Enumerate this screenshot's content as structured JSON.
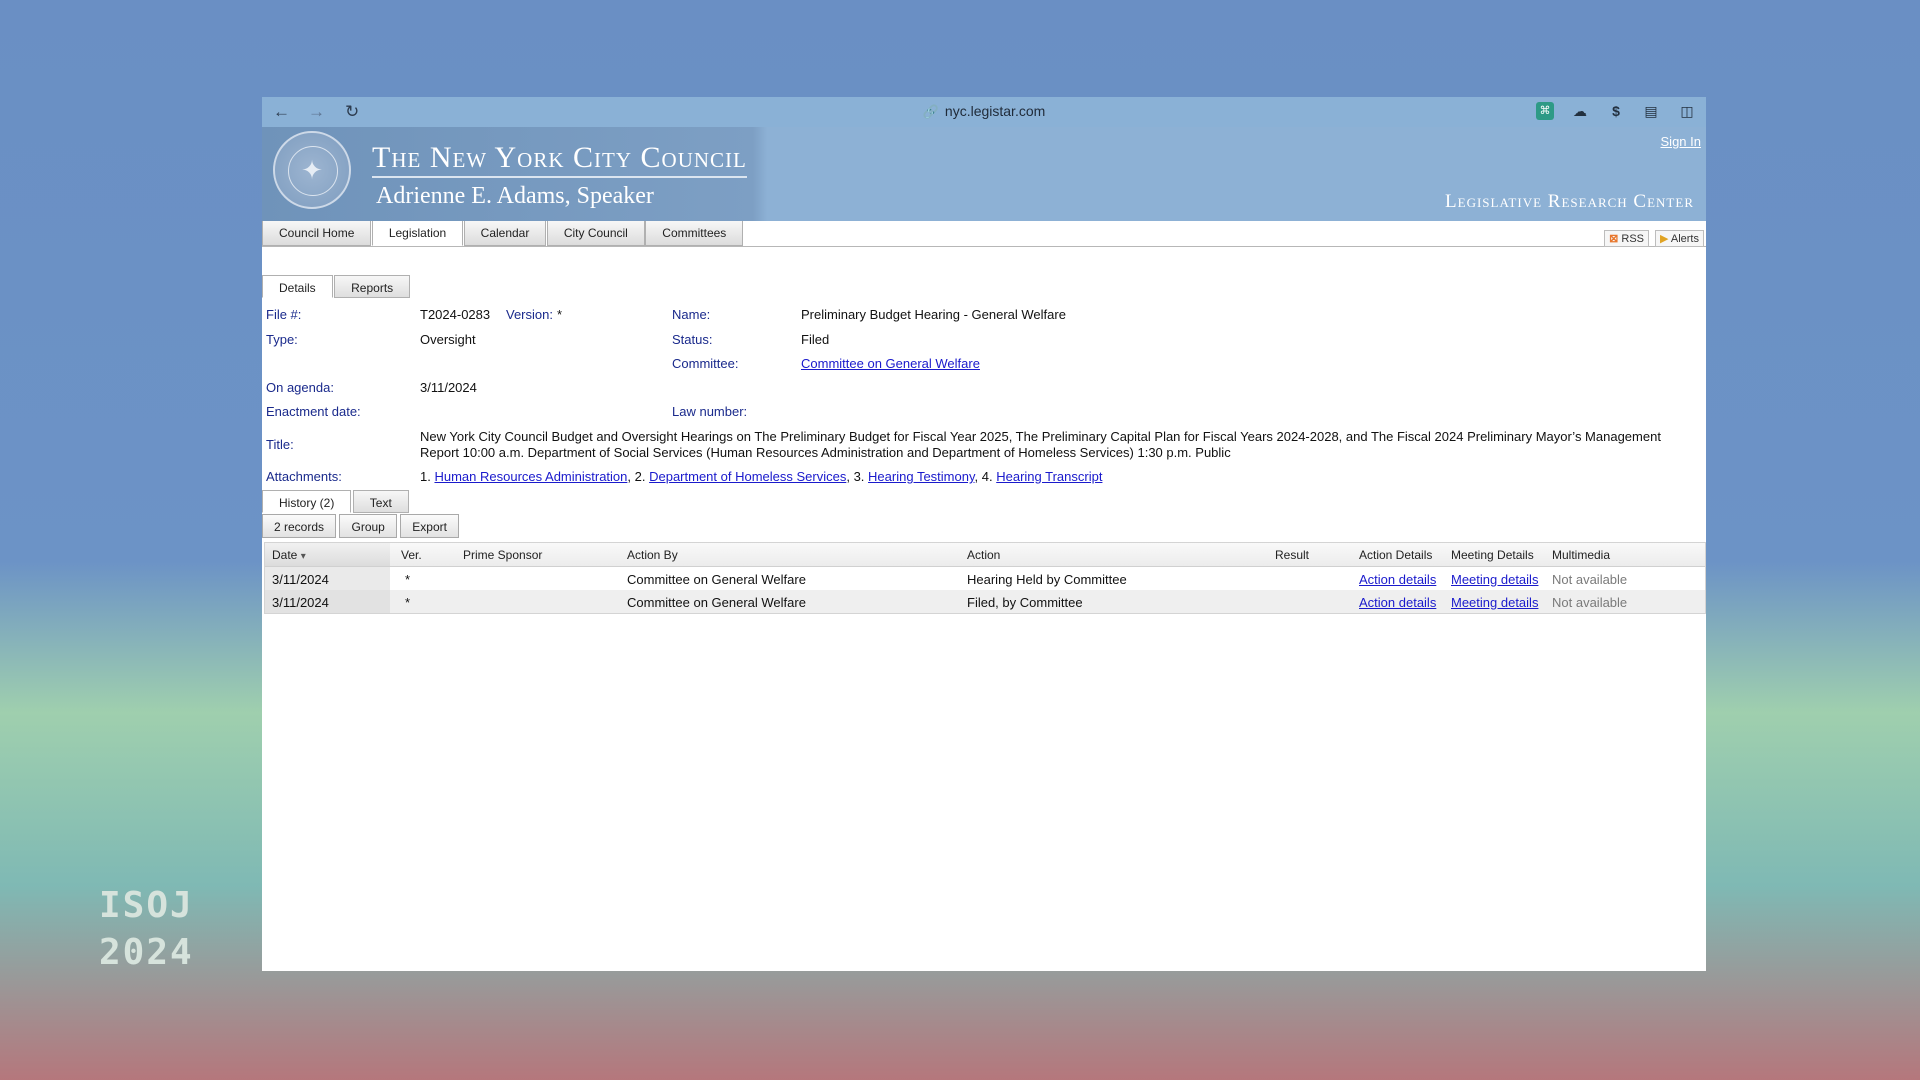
{
  "browser": {
    "url": "nyc.legistar.com",
    "back_glyph": "←",
    "forward_glyph": "→",
    "reload_glyph": "↻"
  },
  "banner": {
    "title": "The New York City Council",
    "speaker": "Adrienne E. Adams, Speaker",
    "center": "Legislative Research Center",
    "sign_in": "Sign In"
  },
  "main_tabs": [
    "Council Home",
    "Legislation",
    "Calendar",
    "City Council",
    "Committees"
  ],
  "feeds": {
    "rss": "RSS",
    "alerts": "Alerts"
  },
  "detail_tabs": [
    "Details",
    "Reports"
  ],
  "details": {
    "file_label": "File #:",
    "file_value": "T2024-0283",
    "version_label": "Version:",
    "version_value": "*",
    "name_label": "Name:",
    "name_value": "Preliminary Budget Hearing - General Welfare",
    "type_label": "Type:",
    "type_value": "Oversight",
    "status_label": "Status:",
    "status_value": "Filed",
    "committee_label": "Committee:",
    "committee_value": "Committee on General Welfare",
    "agenda_label": "On agenda:",
    "agenda_value": "3/11/2024",
    "enactment_label": "Enactment date:",
    "law_label": "Law number:",
    "title_label": "Title:",
    "title_value": "New York City Council Budget and Oversight Hearings on The Preliminary Budget for Fiscal Year 2025, The Preliminary Capital Plan for Fiscal Years 2024-2028, and The Fiscal 2024 Preliminary Mayor’s Management Report 10:00 a.m. Department of Social Services (Human Resources Administration and Department of Homeless Services) 1:30 p.m. Public",
    "attachments_label": "Attachments:",
    "attachments": [
      {
        "num": "1. ",
        "text": "Human Resources Administration",
        "sep": ", "
      },
      {
        "num": "2. ",
        "text": "Department of Homeless Services",
        "sep": ", "
      },
      {
        "num": "3. ",
        "text": "Hearing Testimony",
        "sep": ", "
      },
      {
        "num": "4. ",
        "text": "Hearing Transcript",
        "sep": ""
      }
    ]
  },
  "history_tabs": [
    "History (2)",
    "Text"
  ],
  "toolbar": [
    "2 records",
    "Group",
    "Export"
  ],
  "table": {
    "headers": [
      "Date",
      "Ver.",
      "Prime Sponsor",
      "Action By",
      "Action",
      "Result",
      "Action Details",
      "Meeting Details",
      "Multimedia"
    ],
    "sort_glyph": "▾",
    "rows": [
      {
        "date": "3/11/2024",
        "ver": "*",
        "sponsor": "",
        "action_by": "Committee on General Welfare",
        "action": "Hearing Held by Committee",
        "result": "",
        "action_details": "Action details",
        "meeting_details": "Meeting details",
        "multimedia": "Not available"
      },
      {
        "date": "3/11/2024",
        "ver": "*",
        "sponsor": "",
        "action_by": "Committee on General Welfare",
        "action": "Filed, by Committee",
        "result": "",
        "action_details": "Action details",
        "meeting_details": "Meeting details",
        "multimedia": "Not available"
      }
    ]
  },
  "overlay": {
    "line1": "ISOJ",
    "line2": "2024"
  }
}
